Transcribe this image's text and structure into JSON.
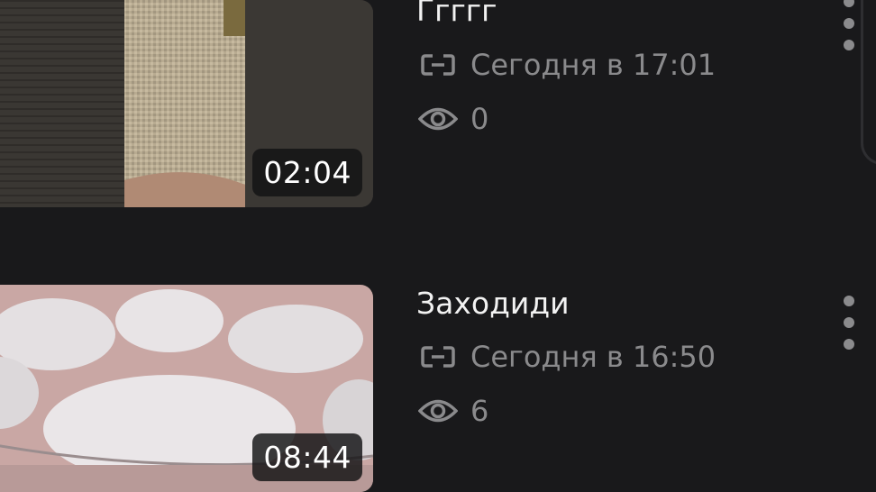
{
  "videos": [
    {
      "title": "Ггггг",
      "date": "Сегодня в 17:01",
      "views": "0",
      "duration": "02:04"
    },
    {
      "title": "Заходиди",
      "date": "Сегодня в 16:50",
      "views": "6",
      "duration": "08:44"
    }
  ],
  "icons": {
    "access": "link-icon",
    "views": "eye-icon",
    "menu": "more-vertical-icon"
  },
  "colors": {
    "background": "#19191b",
    "title": "#f2f2f2",
    "meta": "#8a8a8c"
  }
}
